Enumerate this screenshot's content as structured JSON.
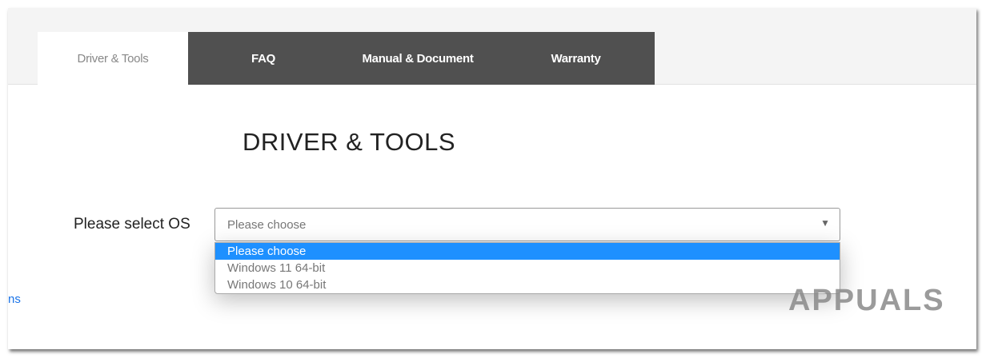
{
  "tabs": [
    {
      "label": "Driver & Tools",
      "active": true
    },
    {
      "label": "FAQ"
    },
    {
      "label": "Manual & Document"
    },
    {
      "label": "Warranty"
    }
  ],
  "section_title": "DRIVER & TOOLS",
  "os_select": {
    "label": "Please select OS",
    "value": "Please choose",
    "options": [
      "Please choose",
      "Windows 11 64-bit",
      "Windows 10 64-bit"
    ]
  },
  "partial_link": "ns",
  "watermark": "APPUALS",
  "colors": {
    "tab_bg": "#505050",
    "highlight": "#1e90ff"
  }
}
